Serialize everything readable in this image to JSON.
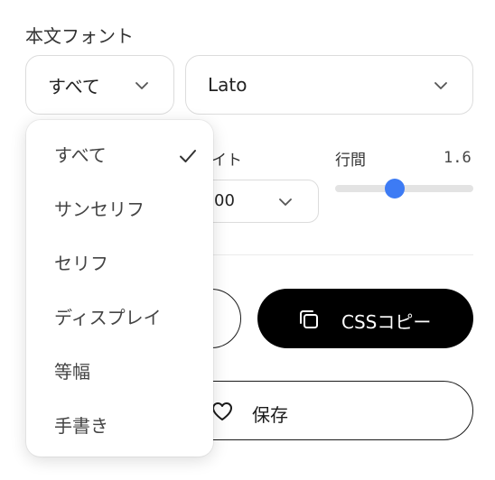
{
  "body_font": {
    "label": "本文フォント",
    "category_select": {
      "value": "すべて"
    },
    "font_select": {
      "value": "Lato"
    }
  },
  "weight": {
    "label_partial": "イト",
    "select_value_partial": "00"
  },
  "line_height": {
    "label": "行間",
    "value": "1.6",
    "slider_fraction": 0.43
  },
  "actions": {
    "copy_css_label": "CSSコピー",
    "save_label": "保存"
  },
  "dropdown": {
    "items": [
      {
        "label": "すべて",
        "selected": true
      },
      {
        "label": "サンセリフ",
        "selected": false
      },
      {
        "label": "セリフ",
        "selected": false
      },
      {
        "label": "ディスプレイ",
        "selected": false
      },
      {
        "label": "等幅",
        "selected": false
      },
      {
        "label": "手書き",
        "selected": false
      }
    ]
  },
  "colors": {
    "accent": "#3d7bf4",
    "primary_button": "#000000"
  }
}
